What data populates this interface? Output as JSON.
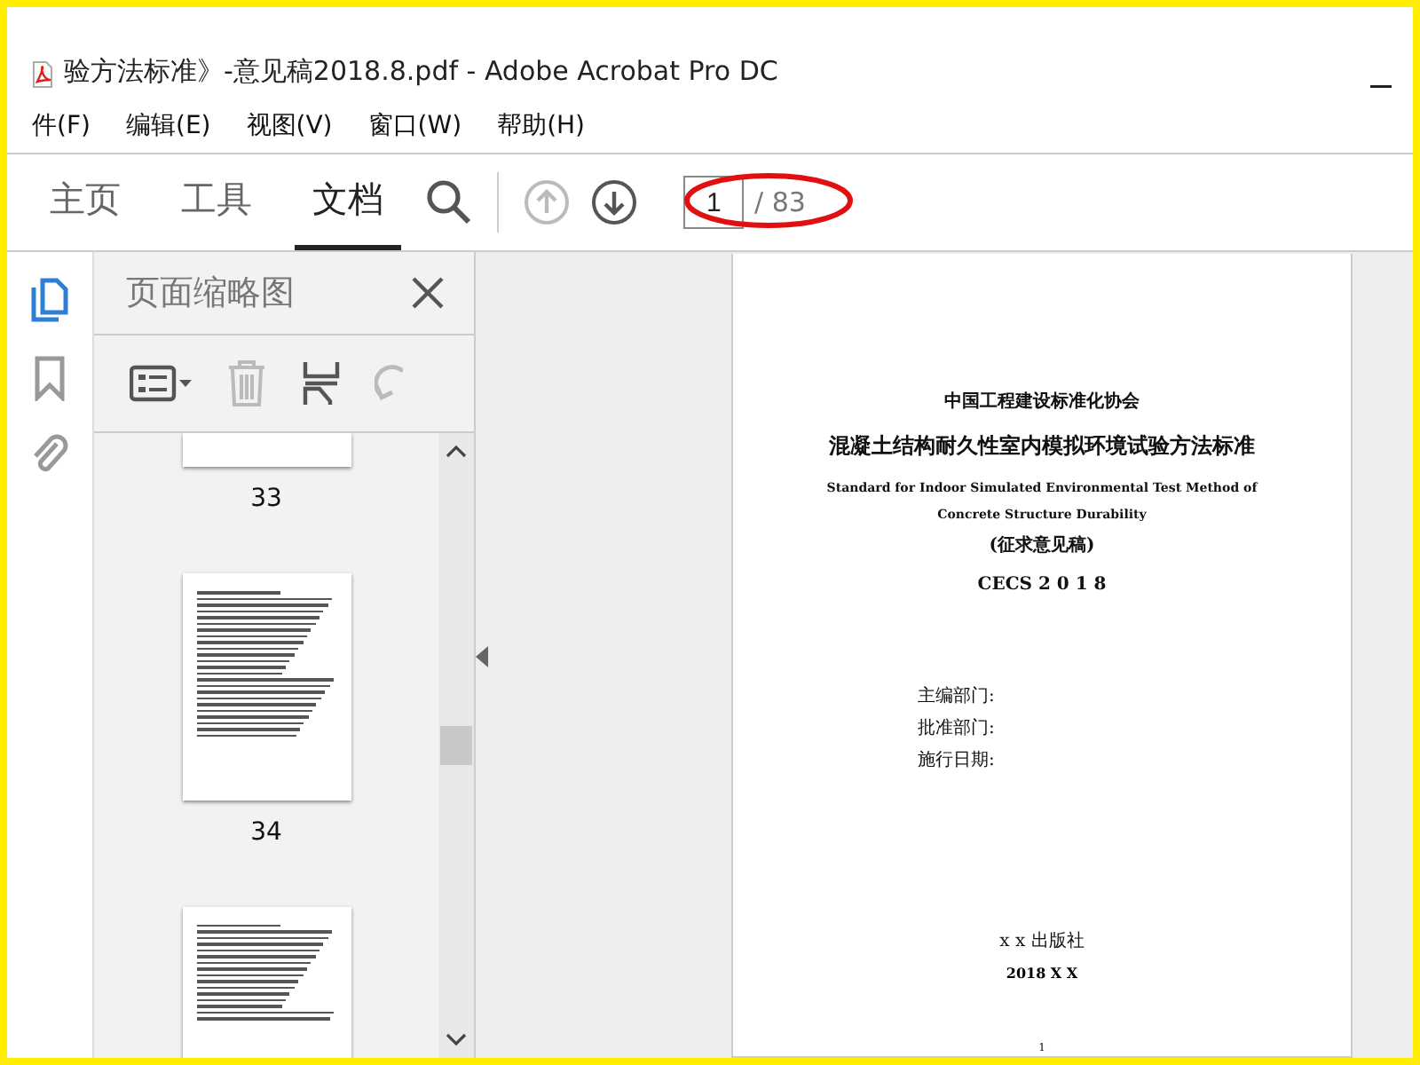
{
  "window": {
    "title": "验方法标准》-意见稿2018.8.pdf - Adobe Acrobat Pro DC"
  },
  "menu": [
    "件(F)",
    "编辑(E)",
    "视图(V)",
    "窗口(W)",
    "帮助(H)"
  ],
  "tabs": [
    {
      "label": "主页",
      "selected": false
    },
    {
      "label": "工具",
      "selected": false
    },
    {
      "label": "文档",
      "selected": true
    }
  ],
  "page_nav": {
    "current": "1",
    "total": "/ 83"
  },
  "side_icons": [
    {
      "kind": "pages",
      "selected": true
    },
    {
      "kind": "bookmark",
      "selected": false
    },
    {
      "kind": "attach",
      "selected": false
    }
  ],
  "panel": {
    "title": "页面缩略图",
    "thumbnails": [
      {
        "kind": "cut_top",
        "label": "33"
      },
      {
        "kind": "full",
        "label": "34"
      },
      {
        "kind": "cut_bottom"
      }
    ]
  },
  "document": {
    "lines": [
      {
        "kind": "cjk",
        "text": "中国工程建设标准化协会"
      },
      {
        "kind": "cjk_big",
        "text": "混凝土结构耐久性室内模拟环境试验方法标准"
      },
      {
        "kind": "latin",
        "text": "Standard for Indoor Simulated Environmental Test Method of"
      },
      {
        "kind": "latin",
        "text": "Concrete Structure Durability"
      },
      {
        "kind": "cjk",
        "text": "(征求意见稿)"
      },
      {
        "kind": "code",
        "text": "CECS 2 0 1 8"
      }
    ],
    "fields": [
      "主编部门:",
      "批准部门:",
      "施行日期:"
    ],
    "publisher": "x x 出版社",
    "date": "2018 X X",
    "page_number": "1"
  }
}
